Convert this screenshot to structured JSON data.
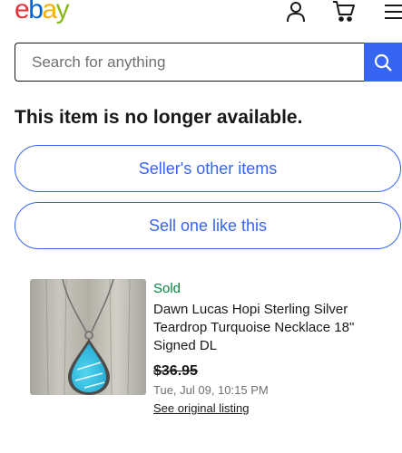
{
  "header": {
    "logo": {
      "e": "e",
      "b": "b",
      "a": "a",
      "y": "y"
    },
    "icons": [
      "account-icon",
      "cart-icon",
      "menu-icon"
    ]
  },
  "search": {
    "placeholder": "Search for anything",
    "value": ""
  },
  "main": {
    "title": "This item is no longer available.",
    "sellers_other_items": "Seller's other items",
    "sell_one_like_this": "Sell one like this"
  },
  "item": {
    "status": "Sold",
    "name": "Dawn Lucas Hopi Sterling Silver Teardrop Turquoise Necklace 18\" Signed DL",
    "price": "$36.95",
    "date": "Tue, Jul 09, 10:15 PM",
    "link": "See original listing"
  },
  "colors": {
    "accent": "#3665f3",
    "sold": "#05823f",
    "text": "#191919",
    "muted": "#707070"
  }
}
